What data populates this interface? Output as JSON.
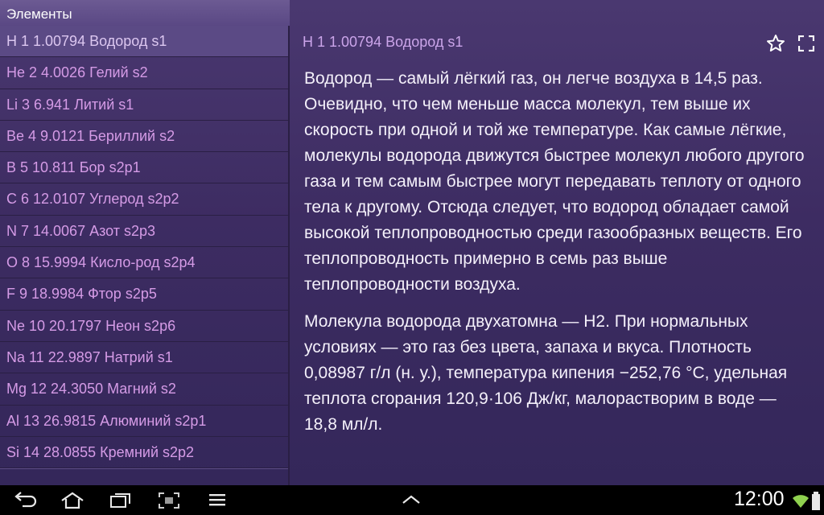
{
  "app": {
    "title": "Элементы"
  },
  "elements": [
    "H 1 1.00794 Водород s1",
    "He 2 4.0026 Гелий s2",
    "Li 3 6.941 Литий s1",
    "Be 4 9.0121 Бериллий s2",
    "B 5 10.811 Бор s2p1",
    "C 6 12.0107 Углерод s2p2",
    "N 7 14.0067 Азот s2p3",
    "O 8 15.9994 Кисло-род s2p4",
    "F 9 18.9984 Фтор s2p5",
    "Ne 10 20.1797 Неон s2p6",
    "Na 11 22.9897 Натрий s1",
    "Mg 12 24.3050 Магний s2",
    "Al 13 26.9815 Алюминий s2p1",
    "Si 14 28.0855 Кремний s2p2"
  ],
  "selected_index": 0,
  "detail": {
    "header": "H 1 1.00794 Водород s1",
    "paragraphs": [
      "Водород — самый лёгкий газ, он легче воздуха в 14,5 раз. Очевидно, что чем меньше масса молекул, тем выше их скорость при одной и той же температуре. Как самые лёгкие, молекулы водорода движутся быстрее молекул любого другого газа и тем самым быстрее могут передавать теплоту от одного тела к другому. Отсюда следует, что водород обладает самой высокой теплопроводностью среди газообразных веществ. Его теплопроводность примерно в семь раз выше теплопроводности воздуха.",
      "Молекула водорода двухатомна — H2. При нормальных условиях — это газ без цвета, запаха и вкуса. Плотность 0,08987 г/л (н. у.), температура кипения −252,76 °C, удельная теплота сгорания 120,9·106 Дж/кг, малорастворим в воде — 18,8 мл/л."
    ]
  },
  "icons": {
    "favorite": "star-icon",
    "fullscreen": "fullscreen-icon"
  },
  "system_bar": {
    "time": "12:00"
  }
}
